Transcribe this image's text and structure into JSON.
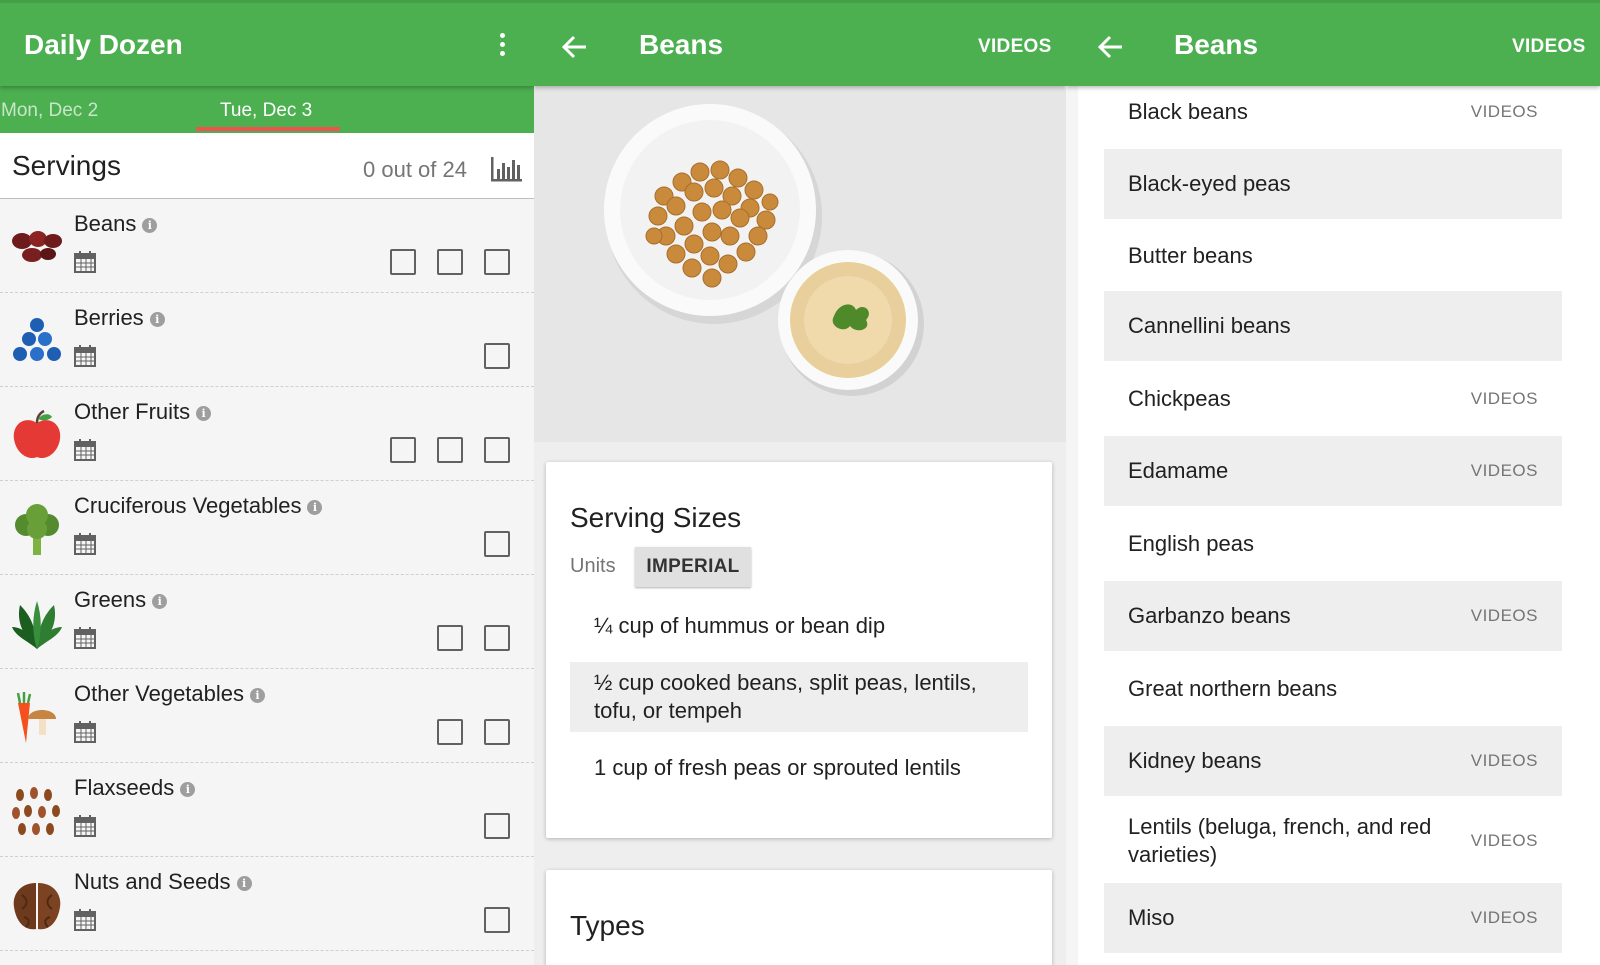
{
  "screen1": {
    "app_title": "Daily Dozen",
    "menu_icon": "more-vert-icon",
    "dates": [
      "Mon, Dec 2",
      "Tue, Dec 3"
    ],
    "active_date": "Tue, Dec 3",
    "servings_label": "Servings",
    "servings_count": "0 out of 24",
    "chart_icon": "bar-chart-icon",
    "items": [
      {
        "name": "Beans",
        "icon": "beans-icon",
        "checkboxes": 3
      },
      {
        "name": "Berries",
        "icon": "berries-icon",
        "checkboxes": 1
      },
      {
        "name": "Other Fruits",
        "icon": "apple-icon",
        "checkboxes": 3
      },
      {
        "name": "Cruciferous Vegetables",
        "icon": "broccoli-icon",
        "checkboxes": 1
      },
      {
        "name": "Greens",
        "icon": "greens-icon",
        "checkboxes": 2
      },
      {
        "name": "Other Vegetables",
        "icon": "carrot-mushroom-icon",
        "checkboxes": 2
      },
      {
        "name": "Flaxseeds",
        "icon": "flaxseeds-icon",
        "checkboxes": 1
      },
      {
        "name": "Nuts and Seeds",
        "icon": "walnut-icon",
        "checkboxes": 1
      }
    ]
  },
  "screen2": {
    "title": "Beans",
    "action": "VIDEOS",
    "serving_sizes_title": "Serving Sizes",
    "units_label": "Units",
    "units_value": "IMPERIAL",
    "sizes": [
      "¼ cup of hummus or bean dip",
      "½ cup cooked beans, split peas, lentils, tofu, or tempeh",
      "1 cup of fresh peas or sprouted lentils"
    ],
    "types_title": "Types"
  },
  "screen3": {
    "title": "Beans",
    "action": "VIDEOS",
    "types": [
      {
        "name": "Black beans",
        "videos": "VIDEOS"
      },
      {
        "name": "Black-eyed peas",
        "videos": ""
      },
      {
        "name": "Butter beans",
        "videos": ""
      },
      {
        "name": "Cannellini beans",
        "videos": ""
      },
      {
        "name": "Chickpeas",
        "videos": "VIDEOS"
      },
      {
        "name": "Edamame",
        "videos": "VIDEOS"
      },
      {
        "name": "English peas",
        "videos": ""
      },
      {
        "name": "Garbanzo beans",
        "videos": "VIDEOS"
      },
      {
        "name": "Great northern beans",
        "videos": ""
      },
      {
        "name": "Kidney beans",
        "videos": "VIDEOS"
      },
      {
        "name": "Lentils (beluga, french, and red varieties)",
        "videos": "VIDEOS"
      },
      {
        "name": "Miso",
        "videos": "VIDEOS"
      }
    ]
  },
  "colors": {
    "primary": "#4caf50",
    "tab_indicator": "#ef5350"
  }
}
